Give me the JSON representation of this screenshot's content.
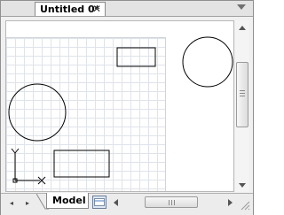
{
  "tabs": {
    "active_label": "Untitled 0*",
    "close_glyph": "✕"
  },
  "layout_tab": {
    "label": "Model"
  },
  "navigation": {
    "prev_glyph": "◂",
    "next_glyph": "▸"
  },
  "canvas": {
    "shapes": [
      "rectangle",
      "circle",
      "circle",
      "rectangle"
    ],
    "ucs_axis_labels": [
      "Y",
      "X"
    ]
  },
  "icons": [
    "tab-menu-arrow-icon",
    "close-icon",
    "layout-sheet-icon",
    "scroll-up-arrow-icon",
    "scroll-down-arrow-icon",
    "scroll-left-arrow-icon",
    "scroll-right-arrow-icon",
    "resize-grip-icon",
    "ucs-icon"
  ],
  "colors": {
    "grid_line": "#dfe3ea",
    "tab_background": "#ffffff",
    "chrome_background": "#ececec"
  }
}
